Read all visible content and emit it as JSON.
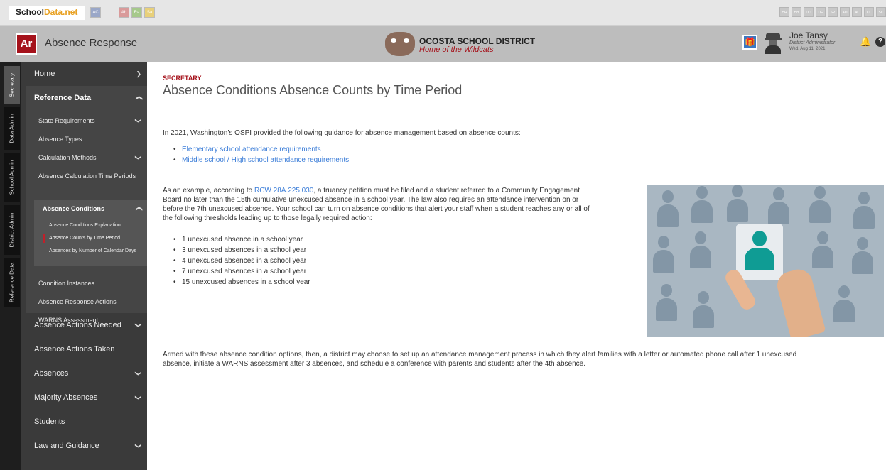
{
  "topbar": {
    "brand_a": "School",
    "brand_b": "Data.net",
    "app_chips": [
      {
        "label": "AC",
        "color": "#9aa7c8"
      },
      {
        "label": "Ab",
        "color": "#d99a9a"
      },
      {
        "label": "Ra",
        "color": "#a6c98b"
      },
      {
        "label": "Sa",
        "color": "#e8d07a"
      }
    ],
    "right_chips": [
      "HR",
      "HB",
      "DD",
      "DE",
      "SP",
      "AD",
      "AL",
      "CL",
      "SC"
    ]
  },
  "header": {
    "logo": "Ar",
    "app_title": "Absence Response",
    "district_name": "OCOSTA SCHOOL DISTRICT",
    "district_tagline": "Home of the Wildcats",
    "user_name": "Joe Tansy",
    "user_role": "District Administrator",
    "user_date": "Wed, Aug 11, 2021",
    "icons": [
      "gift-icon",
      "spy-avatar-icon",
      "bell-icon",
      "help-icon"
    ]
  },
  "vtabs": [
    "Secretary",
    "Data Admin",
    "School Admin",
    "District Admin",
    "Reference Data"
  ],
  "sidebar": {
    "home": "Home",
    "reference_data": "Reference Data",
    "reference_items": [
      "State Requirements",
      "Absence Types",
      "Calculation Methods",
      "Absence Calculation Time Periods"
    ],
    "absence_conditions": "Absence Conditions",
    "condition_items": [
      "Absence Conditions Explanation",
      "Absence Counts by Time Period",
      "Absences by Number of Calendar Days"
    ],
    "more_reference_items": [
      "Condition Instances",
      "Absence Response Actions",
      "WARNS Assessment"
    ],
    "bottom_items": [
      "Absence Actions Needed",
      "Absence Actions Taken",
      "Absences",
      "Majority Absences",
      "Students",
      "Law and Guidance"
    ]
  },
  "main": {
    "section_label": "SECRETARY",
    "title": "Absence Conditions Absence Counts by Time Period",
    "intro": "In 2021, Washington’s OSPI provided the following guidance for absence management based on absence counts:",
    "links": [
      "Elementary school attendance requirements",
      "Middle school / High school attendance requirements"
    ],
    "p2_pre": "As an example, according to ",
    "p2_link": "RCW 28A.225.030",
    "p2_line1_post": ", a truancy petition must be filed and a student referred to a Community Engagement",
    "p2_line2": "Board no later than the 15th cumulative unexcused absence in a school year. The law also requires an attendance intervention on or",
    "p2_line3": "before the 7th unexcused absence. Your school can turn on absence conditions that alert your staff when a student reaches any or all of",
    "p2_line4": "the following thresholds leading up to those legally required action:",
    "thresholds": [
      "1 unexcused absence in a school year",
      "3 unexcused absences in a school year",
      "4 unexcused absences in a school year",
      "7 unexcused absences in a school year",
      "15 unexcused absences in a school year"
    ],
    "closing_line1": "Armed with these absence condition options, then, a district may choose to set up an attendance management process in which they alert families with a letter or automated phone call after 1 unexcused",
    "closing_line2": "absence, initiate a WARNS assessment after 3 absences, and schedule a conference with parents and students after the 4th absence."
  }
}
